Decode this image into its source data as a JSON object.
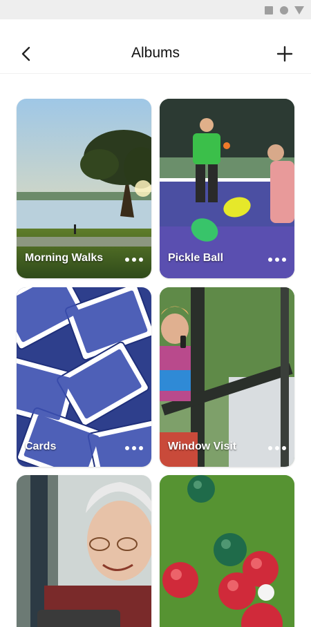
{
  "header": {
    "title": "Albums"
  },
  "albums": [
    {
      "label": "Morning Walks"
    },
    {
      "label": "Pickle Ball"
    },
    {
      "label": "Cards"
    },
    {
      "label": "Window Visit"
    },
    {
      "label": ""
    },
    {
      "label": ""
    }
  ],
  "icons": {
    "back": "chevron-left-icon",
    "add": "plus-icon",
    "more": "more-horizontal-icon"
  }
}
